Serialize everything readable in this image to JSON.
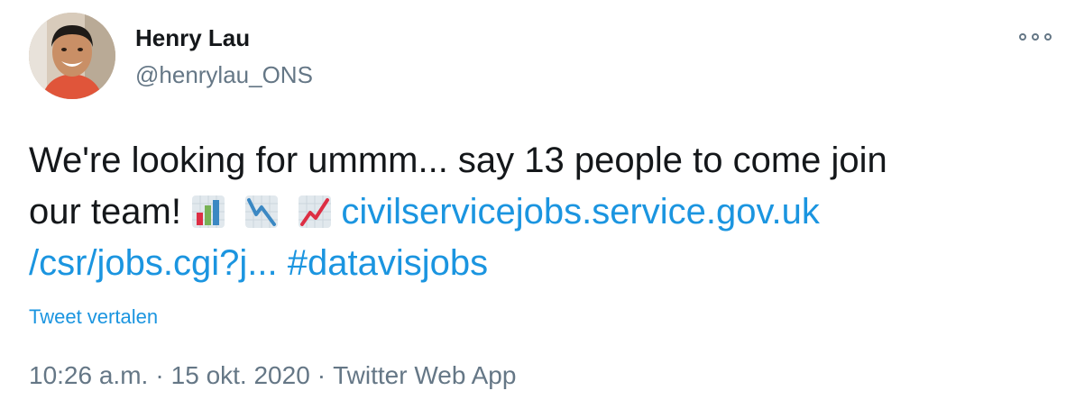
{
  "author": {
    "display_name": "Henry Lau",
    "handle": "@henrylau_ONS"
  },
  "tweet": {
    "text_line1": "We're looking for ummm... say 13 people to come join",
    "text_line2_prefix": "our team!",
    "emojis": [
      "bar-chart-emoji",
      "chart-decreasing-emoji",
      "chart-increasing-emoji"
    ],
    "link_part1": "civilservicejobs.service.gov.uk",
    "link_part2": "/csr/jobs.cgi?j...",
    "hashtag": "#datavisjobs"
  },
  "translate_label": "Tweet vertalen",
  "meta": {
    "time": "10:26 a.m.",
    "separator": "·",
    "date": "15 okt. 2020",
    "source": "Twitter Web App"
  },
  "colors": {
    "link": "#1b95e0",
    "secondary_text": "#657786",
    "primary_text": "#14171a"
  }
}
